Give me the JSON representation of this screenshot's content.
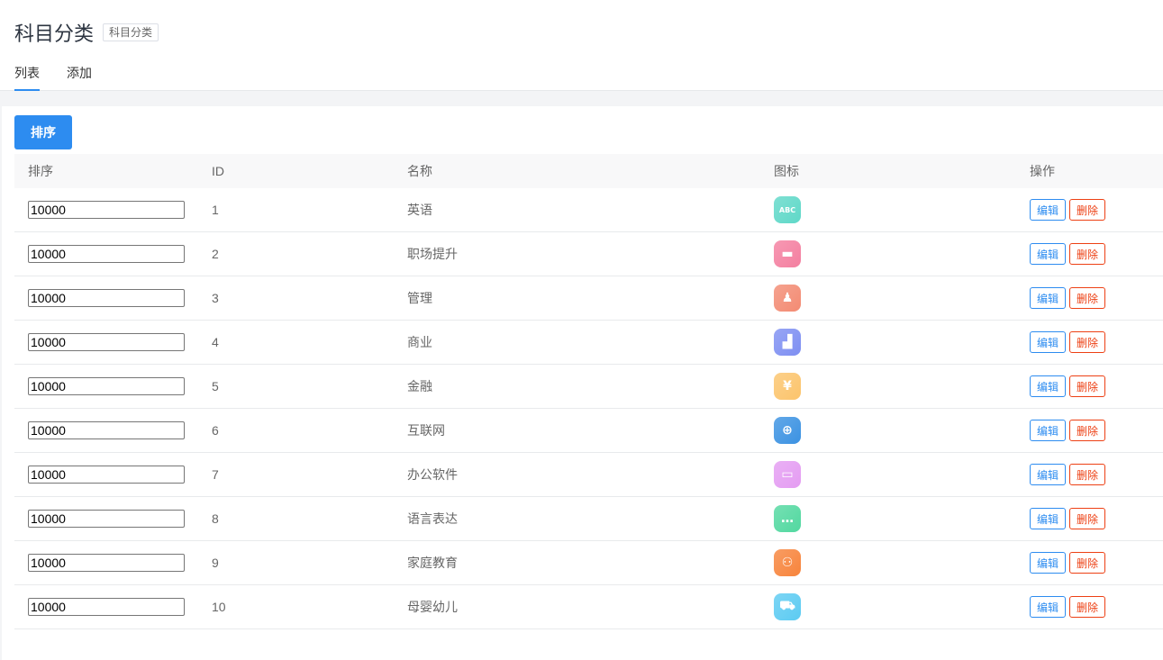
{
  "header": {
    "title": "科目分类",
    "tag": "科目分类",
    "tabs": [
      {
        "label": "列表"
      },
      {
        "label": "添加"
      }
    ]
  },
  "toolbar": {
    "sort_label": "排序"
  },
  "table": {
    "columns": [
      "排序",
      "ID",
      "名称",
      "图标",
      "操作"
    ],
    "edit_label": "编辑",
    "delete_label": "删除",
    "rows": [
      {
        "sort": "10000",
        "id": "1",
        "name": "英语",
        "icon": "abc-blocks-icon",
        "color": "#5fd8c8",
        "glyph": "ABC"
      },
      {
        "sort": "10000",
        "id": "2",
        "name": "职场提升",
        "icon": "briefcase-icon",
        "color": "#f47fa0",
        "glyph": "▬"
      },
      {
        "sort": "10000",
        "id": "3",
        "name": "管理",
        "icon": "person-icon",
        "color": "#f38b73",
        "glyph": "♟"
      },
      {
        "sort": "10000",
        "id": "4",
        "name": "商业",
        "icon": "bar-chart-icon",
        "color": "#7e8ff2",
        "glyph": "▟"
      },
      {
        "sort": "10000",
        "id": "5",
        "name": "金融",
        "icon": "yen-coin-icon",
        "color": "#fcc46c",
        "glyph": "¥"
      },
      {
        "sort": "10000",
        "id": "6",
        "name": "互联网",
        "icon": "globe-icon",
        "color": "#3b92e2",
        "glyph": "⊕"
      },
      {
        "sort": "10000",
        "id": "7",
        "name": "办公软件",
        "icon": "monitor-icon",
        "color": "#e49cf2",
        "glyph": "▭"
      },
      {
        "sort": "10000",
        "id": "8",
        "name": "语言表达",
        "icon": "chat-bubble-icon",
        "color": "#52d8a0",
        "glyph": "…"
      },
      {
        "sort": "10000",
        "id": "9",
        "name": "家庭教育",
        "icon": "family-icon",
        "color": "#f7843c",
        "glyph": "⚇"
      },
      {
        "sort": "10000",
        "id": "10",
        "name": "母婴幼儿",
        "icon": "baby-stroller-icon",
        "color": "#5ccbf2",
        "glyph": "⛟"
      }
    ]
  }
}
